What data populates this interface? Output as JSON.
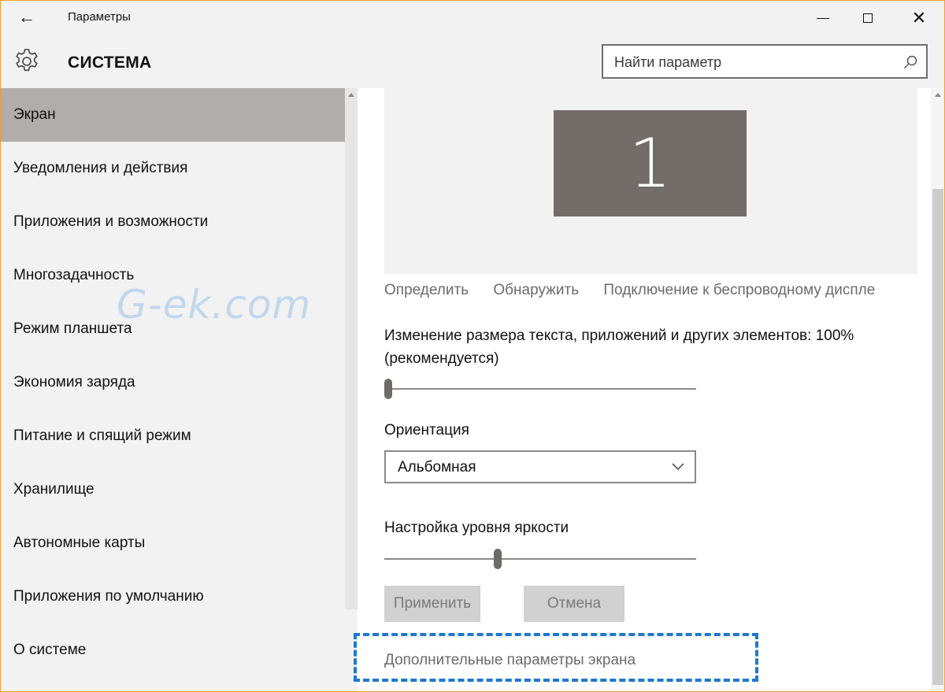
{
  "window": {
    "title": "Параметры",
    "back_icon": "arrow-left-icon",
    "controls": [
      "minimize-icon",
      "maximize-icon",
      "close-icon"
    ]
  },
  "header": {
    "icon": "gear-icon",
    "title": "СИСТЕМА",
    "search": {
      "placeholder": "Найти параметр",
      "value": "",
      "icon": "search-icon"
    }
  },
  "sidebar": {
    "items": [
      {
        "label": "Экран",
        "active": true
      },
      {
        "label": "Уведомления и действия"
      },
      {
        "label": "Приложения и возможности"
      },
      {
        "label": "Многозадачность"
      },
      {
        "label": "Режим планшета"
      },
      {
        "label": "Экономия заряда"
      },
      {
        "label": "Питание и спящий режим"
      },
      {
        "label": "Хранилище"
      },
      {
        "label": "Автономные карты"
      },
      {
        "label": "Приложения по умолчанию"
      },
      {
        "label": "О системе"
      }
    ]
  },
  "display": {
    "monitor_number": "1",
    "links": {
      "identify": "Определить",
      "detect": "Обнаружить",
      "wireless": "Подключение к беспроводному диспле"
    },
    "scale_label": "Изменение размера текста, приложений и других элементов: 100% (рекомендуется)",
    "scale_value": 0.0,
    "orientation_label": "Ориентация",
    "orientation_value": "Альбомная",
    "brightness_label": "Настройка уровня яркости",
    "brightness_value": 0.36,
    "apply_label": "Применить",
    "cancel_label": "Отмена",
    "advanced_link": "Дополнительные параметры экрана"
  },
  "watermark": "G-ek.com",
  "colors": {
    "accent_border": "#f0a030",
    "active_nav": "#b1adaa",
    "monitor": "#736c68",
    "highlight": "#1f78cf"
  }
}
